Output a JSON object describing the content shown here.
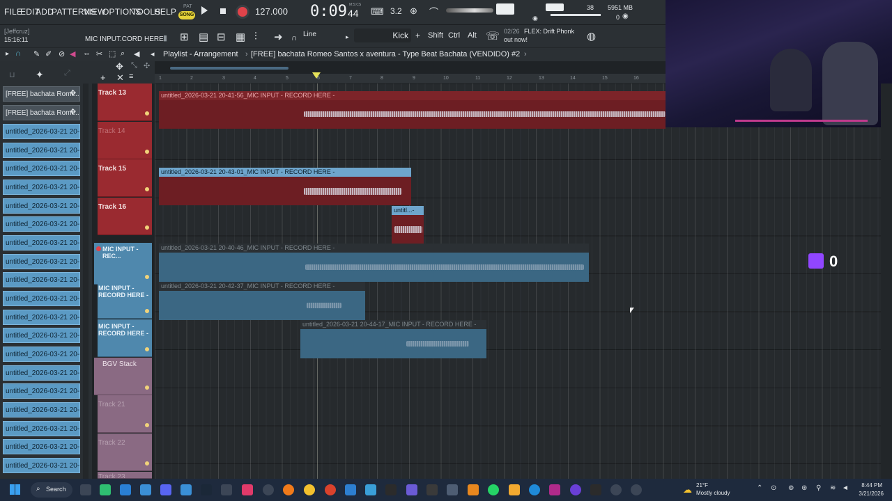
{
  "menu": {
    "items": [
      "FILE",
      "EDIT",
      "ADD",
      "PATTERNS",
      "VIEW",
      "OPTIONS",
      "TOOLS",
      "HELP"
    ],
    "pat_label": "PAT",
    "song_label": "SONG",
    "tempo": "127.000",
    "time": "0:09",
    "time_frac": "44",
    "time_unit": "M:S:CS",
    "cpu": "38",
    "memory": "5951 MB",
    "voices": "0"
  },
  "toolbar2": {
    "user": "[Jeffcruz]",
    "clock": "15:16:11",
    "hint": "MIC INPUT.CORD HERE",
    "snap": "Line",
    "pattern_name": "Kick",
    "mod_keys": [
      "Shift",
      "Ctrl",
      "Alt"
    ],
    "news_count": "02/26",
    "news_text": "FLEX: Drift Phonk",
    "news_sub": "out now!"
  },
  "playlist": {
    "title": "Playlist - Arrangement",
    "project": "[FREE] bachata Romeo Santos x aventura - Type Beat Bachata (VENDIDO) #2",
    "ruler": [
      "1",
      "2",
      "3",
      "4",
      "5",
      "6",
      "7",
      "8",
      "9",
      "10",
      "11",
      "12",
      "13",
      "14",
      "15",
      "16"
    ]
  },
  "browser": {
    "items": [
      "[FREE] bachata Rome...",
      "[FREE] bachata Rome...",
      "untitled_2026-03-21 20-...",
      "untitled_2026-03-21 20-...",
      "untitled_2026-03-21 20-...",
      "untitled_2026-03-21 20-...",
      "untitled_2026-03-21 20-...",
      "untitled_2026-03-21 20-...",
      "untitled_2026-03-21 20-...",
      "untitled_2026-03-21 20-...",
      "untitled_2026-03-21 20-...",
      "untitled_2026-03-21 20-...",
      "untitled_2026-03-21 20-...",
      "untitled_2026-03-21 20-...",
      "untitled_2026-03-21 20-...",
      "untitled_2026-03-21 20-...",
      "untitled_2026-03-21 20-...",
      "untitled_2026-03-21 20-...",
      "untitled_2026-03-21 20-...",
      "untitled_2026-03-21 20-...",
      "untitled_2026-03-21 20-..."
    ]
  },
  "tracks": [
    {
      "name": "Track 13"
    },
    {
      "name": "Track 14"
    },
    {
      "name": "Track 15"
    },
    {
      "name": "Track 16"
    },
    {
      "name": "MIC INPUT - REC..."
    },
    {
      "name": "MIC INPUT - RECORD HERE -"
    },
    {
      "name": "MIC INPUT - RECORD HERE -"
    },
    {
      "name": "BGV Stack"
    },
    {
      "name": "Track 21"
    },
    {
      "name": "Track 22"
    },
    {
      "name": "Track 23"
    }
  ],
  "clips": [
    {
      "label": "untitled_2026-03-21 20-41-56_MIC INPUT - RECORD HERE -"
    },
    {
      "label": "untitled_2026-03-21 20-43-01_MIC INPUT - RECORD HERE -"
    },
    {
      "label": "untitl...-"
    },
    {
      "label": "untitled_2026-03-21 20-40-46_MIC INPUT - RECORD HERE -"
    },
    {
      "label": "untitled_2026-03-21 20-42-37_MIC INPUT - RECORD HERE -"
    },
    {
      "label": "untitled_2026-03-21 20-44-17_MIC INPUT - RECORD HERE -"
    }
  ],
  "overlay": {
    "twitch_count": "0"
  },
  "taskbar": {
    "search": "Search",
    "weather_temp": "21°F",
    "weather_desc": "Mostly cloudy",
    "time": "8:44 PM",
    "date": "3/21/2026"
  },
  "colors": {
    "accent_red": "#9a2a30",
    "accent_blue": "#4f88ad",
    "bgv_pink": "#8a6a83",
    "record": "#e0434a"
  }
}
